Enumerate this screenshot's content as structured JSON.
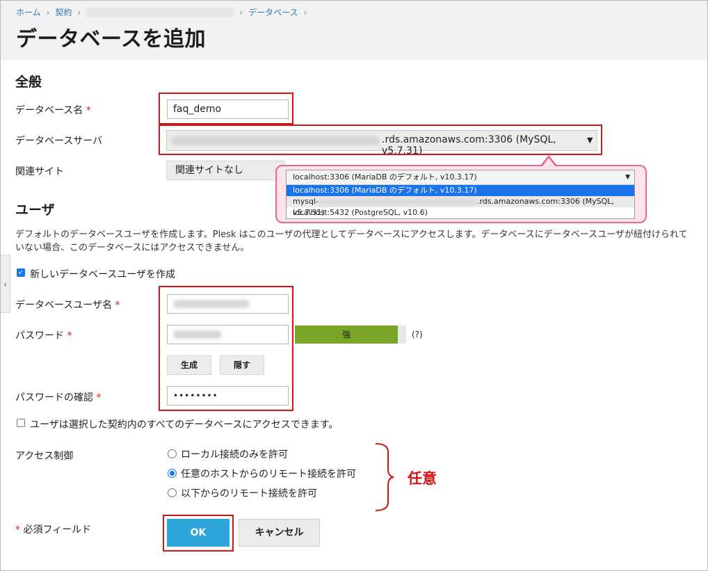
{
  "breadcrumb": {
    "home": "ホーム",
    "contract": "契約",
    "databases": "データベース",
    "separator": "›"
  },
  "page_title": "データベースを追加",
  "general": {
    "heading": "全般",
    "db_name_label": "データベース名",
    "db_name_value": "faq_demo",
    "db_server_label": "データベースサーバ",
    "db_server_value": ".rds.amazonaws.com:3306 (MySQL, v5.7.31)",
    "related_site_label": "関連サイト",
    "related_site_value": "関連サイトなし"
  },
  "server_dropdown": {
    "head": "localhost:3306 (MariaDB のデフォルト, v10.3.17)",
    "options": [
      "localhost:3306 (MariaDB のデフォルト, v10.3.17)",
      "mysql-",
      ".rds.amazonaws.com:3306 (MySQL, v5.7.31)",
      "localhost:5432 (PostgreSQL, v10.6)"
    ]
  },
  "user": {
    "heading": "ユーザ",
    "description": "デフォルトのデータベースユーザを作成します。Plesk はこのユーザの代理としてデータベースにアクセスします。データベースにデータベースユーザが紐付けられていない場合、このデータベースにはアクセスできません。",
    "create_user_label": "新しいデータベースユーザを作成",
    "username_label": "データベースユーザ名",
    "password_label": "パスワード",
    "strength_label": "強",
    "help_label": "(?)",
    "generate_button": "生成",
    "hide_button": "隠す",
    "confirm_label": "パスワードの確認",
    "confirm_value": "••••••••",
    "all_databases_label": "ユーザは選択した契約内のすべてのデータベースにアクセスできます。"
  },
  "access": {
    "label": "アクセス制御",
    "options": [
      "ローカル接続のみを許可",
      "任意のホストからのリモート接続を許可",
      "以下からのリモート接続を許可"
    ],
    "selected_index": 1,
    "annotation": "任意"
  },
  "footer": {
    "required_note": "必須フィールド",
    "ok_button": "OK",
    "cancel_button": "キャンセル"
  },
  "required_mark": "*",
  "colors": {
    "link": "#2a79bd",
    "primary": "#2fa5dc",
    "highlight": "#d11414",
    "strength": "#7aa628"
  }
}
